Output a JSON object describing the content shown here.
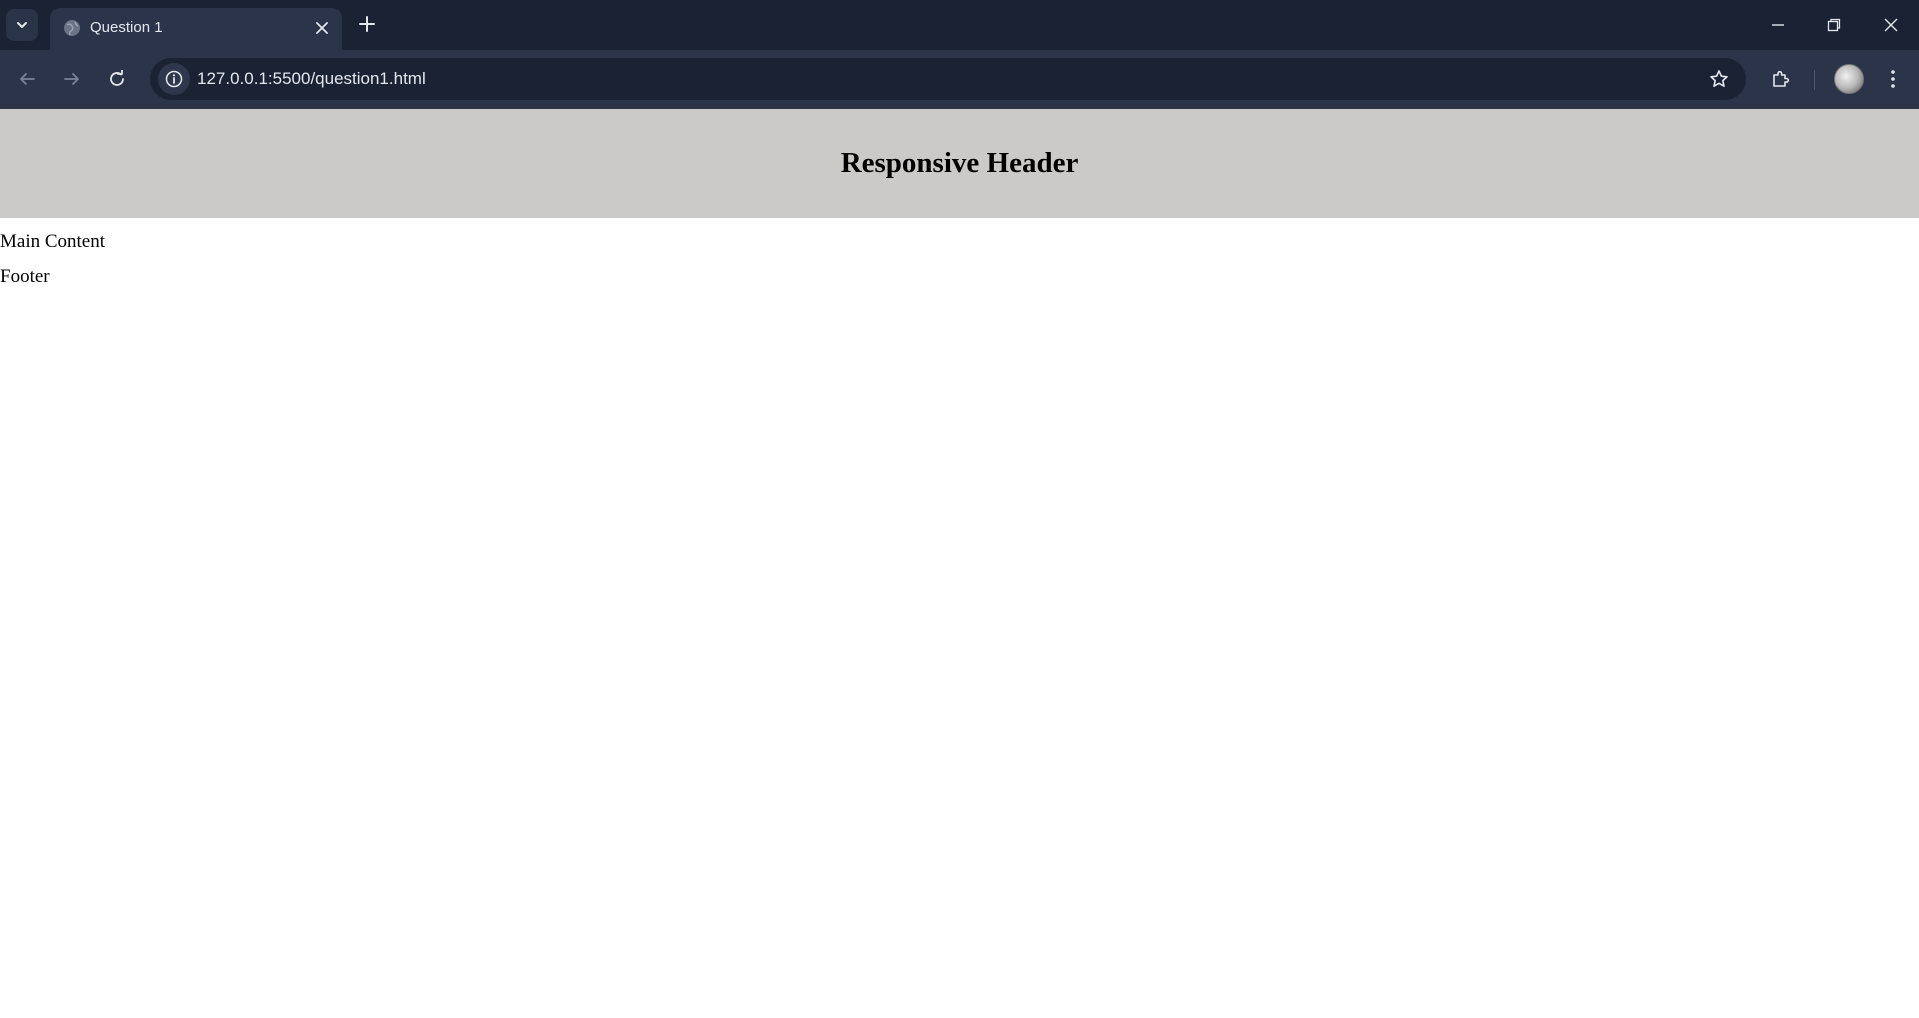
{
  "browser": {
    "tab": {
      "title": "Question 1"
    },
    "address_bar": {
      "url": "127.0.0.1:5500/question1.html"
    },
    "icons": {
      "tab_search": "chevron-down-icon",
      "favicon": "globe-icon",
      "tab_close": "close-icon",
      "new_tab": "plus-icon",
      "back": "arrow-left-icon",
      "forward": "arrow-right-icon",
      "reload": "reload-icon",
      "site_info": "info-icon",
      "bookmark": "star-icon",
      "extensions": "puzzle-icon",
      "menu": "kebab-menu-icon",
      "minimize": "minimize-icon",
      "restore": "restore-icon",
      "close_window": "close-icon"
    },
    "colors": {
      "tabstrip": "#1b2233",
      "toolbar": "#2b3448",
      "omnibox": "#1b2233"
    }
  },
  "page": {
    "header": {
      "title": "Responsive Header",
      "background": "#cbcac9"
    },
    "main": {
      "text": "Main Content"
    },
    "footer": {
      "text": "Footer"
    }
  }
}
